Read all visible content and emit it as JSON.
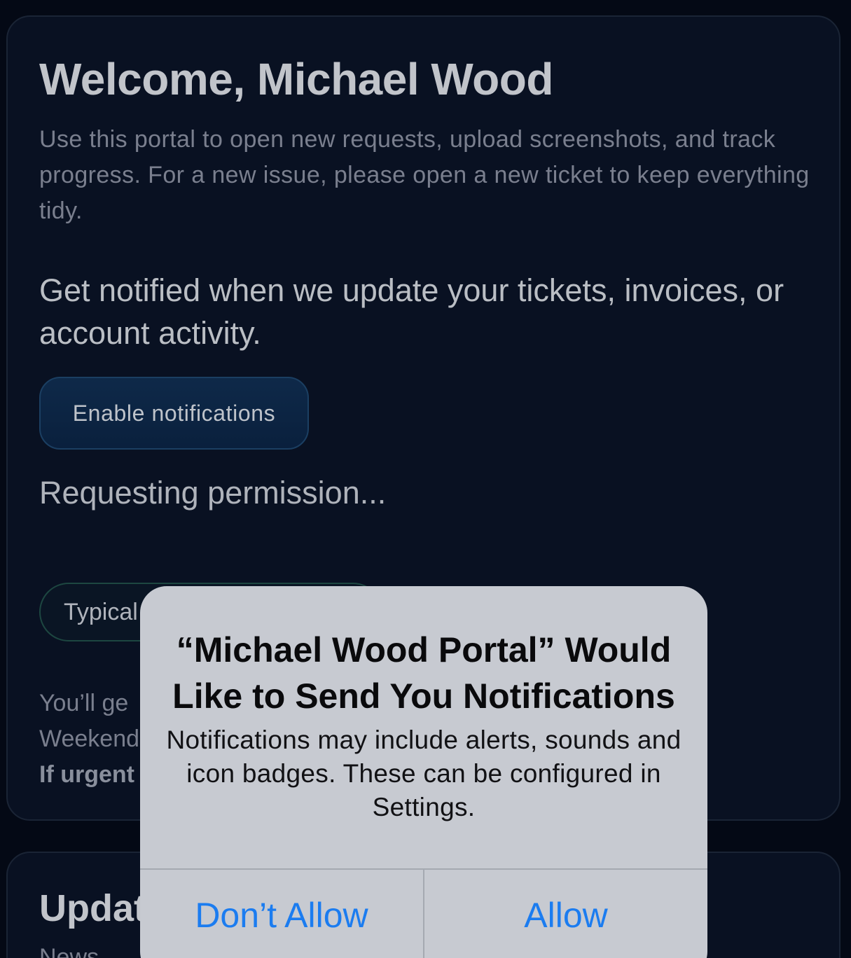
{
  "welcome": {
    "title": "Welcome, Michael Wood",
    "intro": "Use this portal to open new requests, upload screenshots, and track progress. For a new issue, please open a new ticket to keep everything tidy."
  },
  "notifications": {
    "prompt": "Get notified when we update your tickets, invoices, or account activity.",
    "enable_label": "Enable notifications",
    "status": "Requesting permission..."
  },
  "hours": {
    "pill_label": "Typical",
    "line1": "You’ll ge",
    "line2": "Weekend",
    "line3_bold": "If urgent"
  },
  "updates": {
    "title": "Updat",
    "subtitle": "News"
  },
  "alert": {
    "title": "“Michael Wood Portal” Would Like to Send You Notifications",
    "message": "Notifications may include alerts, sounds and icon badges. These can be configured in Settings.",
    "deny_label": "Don’t Allow",
    "allow_label": "Allow"
  },
  "colors": {
    "background": "#050a16",
    "card": "#0a1224",
    "accent_button": "#0f2b4c",
    "alert_background": "#c7cad1",
    "alert_action": "#1b7cf0"
  }
}
